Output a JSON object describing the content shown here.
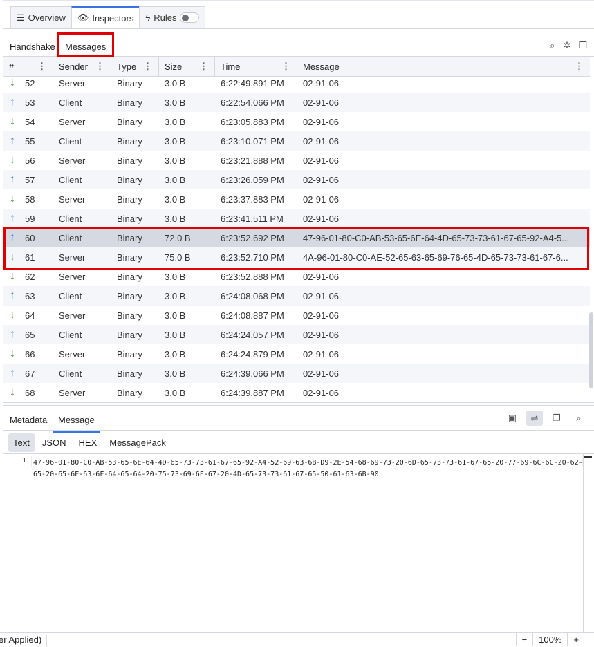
{
  "tabs": [
    {
      "label": "Overview",
      "icon": "chart-icon"
    },
    {
      "label": "Inspectors",
      "icon": "eye-icon",
      "active": true
    },
    {
      "label": "Rules",
      "icon": "bolt-icon",
      "toggle": false
    }
  ],
  "subtabs": {
    "handshake": "Handshake",
    "messages": "Messages"
  },
  "columns": [
    "#",
    "Sender",
    "Type",
    "Size",
    "Time",
    "Message"
  ],
  "rows": [
    {
      "n": "52",
      "dir": "down",
      "sender": "Server",
      "type": "Binary",
      "size": "3.0 B",
      "time": "6:22:49.891 PM",
      "message": "02-91-06"
    },
    {
      "n": "53",
      "dir": "up",
      "sender": "Client",
      "type": "Binary",
      "size": "3.0 B",
      "time": "6:22:54.066 PM",
      "message": "02-91-06"
    },
    {
      "n": "54",
      "dir": "down",
      "sender": "Server",
      "type": "Binary",
      "size": "3.0 B",
      "time": "6:23:05.883 PM",
      "message": "02-91-06"
    },
    {
      "n": "55",
      "dir": "up",
      "sender": "Client",
      "type": "Binary",
      "size": "3.0 B",
      "time": "6:23:10.071 PM",
      "message": "02-91-06"
    },
    {
      "n": "56",
      "dir": "down",
      "sender": "Server",
      "type": "Binary",
      "size": "3.0 B",
      "time": "6:23:21.888 PM",
      "message": "02-91-06"
    },
    {
      "n": "57",
      "dir": "up",
      "sender": "Client",
      "type": "Binary",
      "size": "3.0 B",
      "time": "6:23:26.059 PM",
      "message": "02-91-06"
    },
    {
      "n": "58",
      "dir": "down",
      "sender": "Server",
      "type": "Binary",
      "size": "3.0 B",
      "time": "6:23:37.883 PM",
      "message": "02-91-06"
    },
    {
      "n": "59",
      "dir": "up",
      "sender": "Client",
      "type": "Binary",
      "size": "3.0 B",
      "time": "6:23:41.511 PM",
      "message": "02-91-06"
    },
    {
      "n": "60",
      "dir": "up",
      "sender": "Client",
      "type": "Binary",
      "size": "72.0 B",
      "time": "6:23:52.692 PM",
      "message": "47-96-01-80-C0-AB-53-65-6E-64-4D-65-73-73-61-67-65-92-A4-5...",
      "selected": true
    },
    {
      "n": "61",
      "dir": "down",
      "sender": "Server",
      "type": "Binary",
      "size": "75.0 B",
      "time": "6:23:52.710 PM",
      "message": "4A-96-01-80-C0-AE-52-65-63-65-69-76-65-4D-65-73-73-61-67-6..."
    },
    {
      "n": "62",
      "dir": "down",
      "sender": "Server",
      "type": "Binary",
      "size": "3.0 B",
      "time": "6:23:52.888 PM",
      "message": "02-91-06"
    },
    {
      "n": "63",
      "dir": "up",
      "sender": "Client",
      "type": "Binary",
      "size": "3.0 B",
      "time": "6:24:08.068 PM",
      "message": "02-91-06"
    },
    {
      "n": "64",
      "dir": "down",
      "sender": "Server",
      "type": "Binary",
      "size": "3.0 B",
      "time": "6:24:08.887 PM",
      "message": "02-91-06"
    },
    {
      "n": "65",
      "dir": "up",
      "sender": "Client",
      "type": "Binary",
      "size": "3.0 B",
      "time": "6:24:24.057 PM",
      "message": "02-91-06"
    },
    {
      "n": "66",
      "dir": "down",
      "sender": "Server",
      "type": "Binary",
      "size": "3.0 B",
      "time": "6:24:24.879 PM",
      "message": "02-91-06"
    },
    {
      "n": "67",
      "dir": "up",
      "sender": "Client",
      "type": "Binary",
      "size": "3.0 B",
      "time": "6:24:39.066 PM",
      "message": "02-91-06"
    },
    {
      "n": "68",
      "dir": "down",
      "sender": "Server",
      "type": "Binary",
      "size": "3.0 B",
      "time": "6:24:39.887 PM",
      "message": "02-91-06"
    }
  ],
  "detail": {
    "tabs": {
      "metadata": "Metadata",
      "message": "Message"
    },
    "formats": [
      "Text",
      "JSON",
      "HEX",
      "MessagePack"
    ],
    "line_number": "1",
    "content": "47-96-01-80-C0-AB-53-65-6E-64-4D-65-73-73-61-67-65-92-A4-52-69-63-6B-D9-2E-54-68-69-73-20-6D-65-73-73-61-67-65-20-77-69-6C-6C-20-62-65-20-65-6E-63-6F-64-65-64-20-75-73-69-6E-67-20-4D-65-73-73-61-67-65-50-61-63-6B-90"
  },
  "status": {
    "left": "er Applied)",
    "zoom": "100%",
    "minus": "−",
    "plus": "+"
  },
  "colors": {
    "accent": "#3b74e0",
    "highlight": "#e00000",
    "up": "#2f72e0",
    "down": "#2b8a2e"
  }
}
